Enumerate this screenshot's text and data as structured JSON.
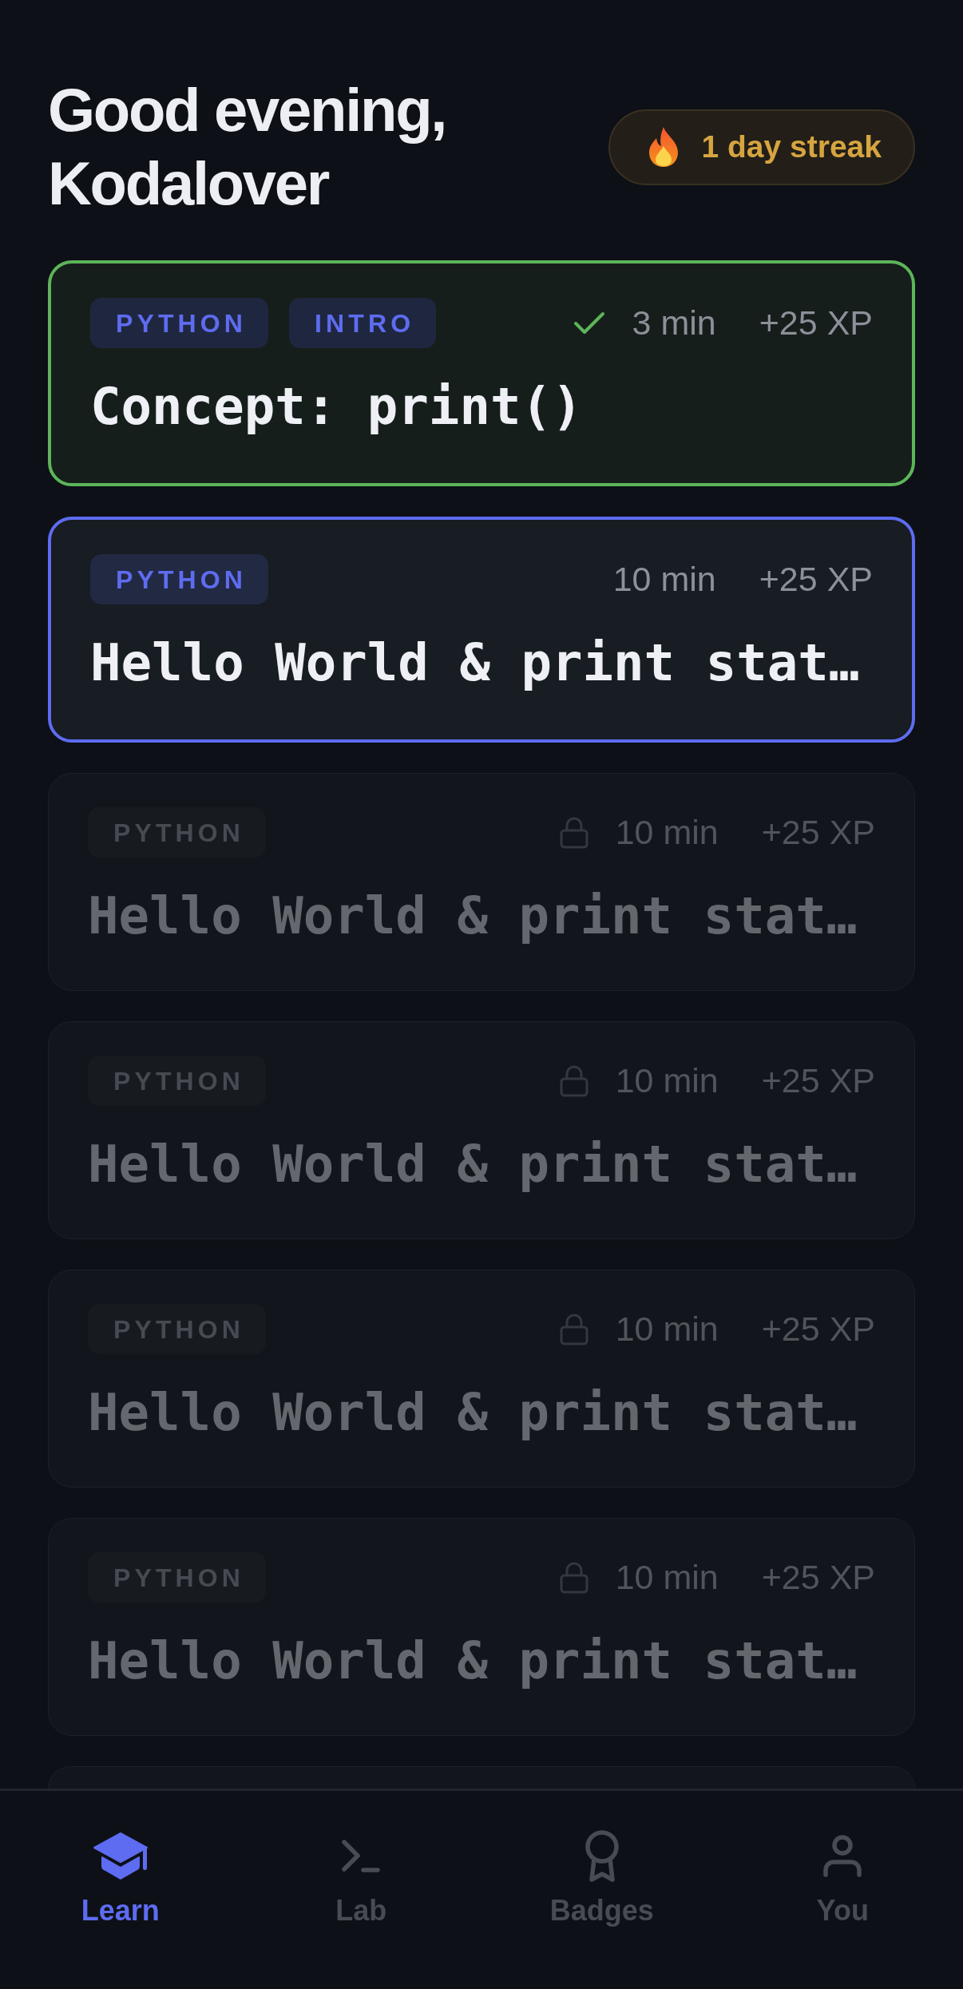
{
  "greeting": {
    "lines": [
      "Good evening,",
      "Kodalover"
    ]
  },
  "streak": {
    "label": "1 day streak"
  },
  "lessons": [
    {
      "tags": [
        "PYTHON",
        "INTRO"
      ],
      "kind": "completed",
      "duration": "3 min",
      "xp": "+25 XP",
      "title": "Concept: print()",
      "cut_off": false
    },
    {
      "tags": [
        "PYTHON"
      ],
      "kind": "current",
      "duration": "10 min",
      "xp": "+25 XP",
      "title": "Hello World & print stat…",
      "cut_off": false
    },
    {
      "tags": [
        "PYTHON"
      ],
      "kind": "locked",
      "duration": "10 min",
      "xp": "+25 XP",
      "title": "Hello World & print stat…",
      "cut_off": false
    },
    {
      "tags": [
        "PYTHON"
      ],
      "kind": "locked",
      "duration": "10 min",
      "xp": "+25 XP",
      "title": "Hello World & print stat…",
      "cut_off": false
    },
    {
      "tags": [
        "PYTHON"
      ],
      "kind": "locked",
      "duration": "10 min",
      "xp": "+25 XP",
      "title": "Hello World & print stat…",
      "cut_off": false
    },
    {
      "tags": [
        "PYTHON"
      ],
      "kind": "locked",
      "duration": "10 min",
      "xp": "+25 XP",
      "title": "Hello World & print stat…",
      "cut_off": false
    },
    {
      "kind": "locked",
      "cut_off": true
    }
  ],
  "nav": {
    "items": [
      {
        "label": "Learn",
        "selected": true
      },
      {
        "label": "Lab",
        "selected": false
      },
      {
        "label": "Badges",
        "selected": false
      },
      {
        "label": "You",
        "selected": false
      }
    ]
  }
}
